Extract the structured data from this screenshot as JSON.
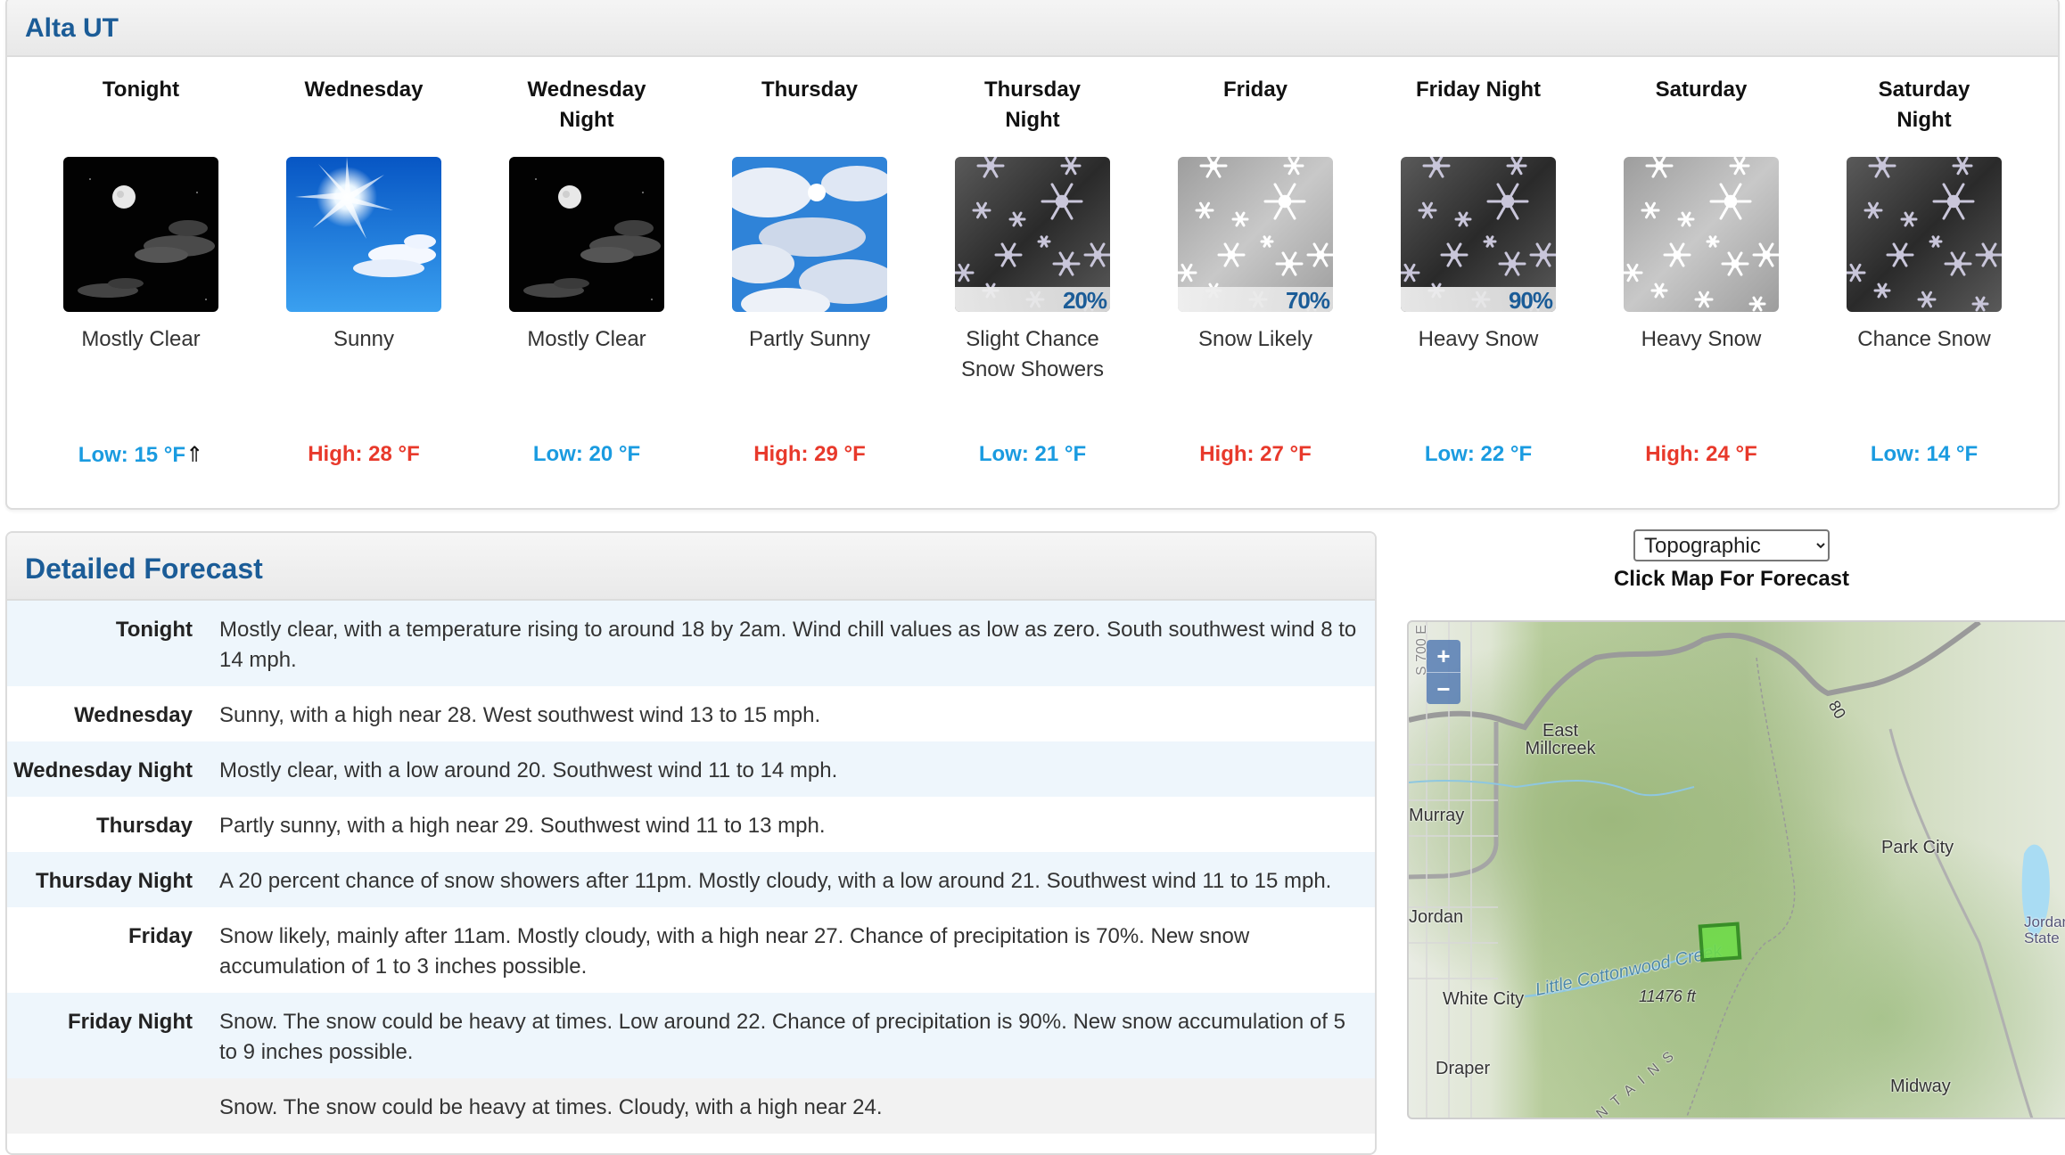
{
  "location": {
    "title": "Alta UT"
  },
  "periods": [
    {
      "name": "Tonight",
      "icon": "night-clear-moon-icon",
      "pop": null,
      "short_desc": "Mostly Clear",
      "temp_label": "Low: 15 °F",
      "temp_type": "low",
      "trend_icon": "rising-arrow-icon"
    },
    {
      "name": "Wednesday",
      "icon": "sunny-icon",
      "pop": null,
      "short_desc": "Sunny",
      "temp_label": "High: 28 °F",
      "temp_type": "high"
    },
    {
      "name": "Wednesday Night",
      "icon": "night-clear-moon-icon",
      "pop": null,
      "short_desc": "Mostly Clear",
      "temp_label": "Low: 20 °F",
      "temp_type": "low"
    },
    {
      "name": "Thursday",
      "icon": "partly-sunny-icon",
      "pop": null,
      "short_desc": "Partly Sunny",
      "temp_label": "High: 29 °F",
      "temp_type": "high"
    },
    {
      "name": "Thursday Night",
      "icon": "snow-night-icon",
      "pop": "20%",
      "short_desc": "Slight Chance Snow Showers",
      "temp_label": "Low: 21 °F",
      "temp_type": "low"
    },
    {
      "name": "Friday",
      "icon": "snow-day-icon",
      "pop": "70%",
      "short_desc": "Snow Likely",
      "temp_label": "High: 27 °F",
      "temp_type": "high"
    },
    {
      "name": "Friday Night",
      "icon": "snow-night-icon",
      "pop": "90%",
      "short_desc": "Heavy Snow",
      "temp_label": "Low: 22 °F",
      "temp_type": "low"
    },
    {
      "name": "Saturday",
      "icon": "snow-day-icon",
      "pop": null,
      "short_desc": "Heavy Snow",
      "temp_label": "High: 24 °F",
      "temp_type": "high"
    },
    {
      "name": "Saturday Night",
      "icon": "snow-night-icon",
      "pop": null,
      "short_desc": "Chance Snow",
      "temp_label": "Low: 14 °F",
      "temp_type": "low"
    }
  ],
  "detailed": {
    "title": "Detailed Forecast",
    "rows": [
      {
        "label": "Tonight",
        "text": "Mostly clear, with a temperature rising to around 18 by 2am. Wind chill values as low as zero. South southwest wind 8 to 14 mph."
      },
      {
        "label": "Wednesday",
        "text": "Sunny, with a high near 28. West southwest wind 13 to 15 mph."
      },
      {
        "label": "Wednesday Night",
        "text": "Mostly clear, with a low around 20. Southwest wind 11 to 14 mph."
      },
      {
        "label": "Thursday",
        "text": "Partly sunny, with a high near 29. Southwest wind 11 to 13 mph."
      },
      {
        "label": "Thursday Night",
        "text": "A 20 percent chance of snow showers after 11pm. Mostly cloudy, with a low around 21. Southwest wind 11 to 15 mph."
      },
      {
        "label": "Friday",
        "text": "Snow likely, mainly after 11am. Mostly cloudy, with a high near 27. Chance of precipitation is 70%. New snow accumulation of 1 to 3 inches possible."
      },
      {
        "label": "Friday Night",
        "text": "Snow. The snow could be heavy at times. Low around 22. Chance of precipitation is 90%. New snow accumulation of 5 to 9 inches possible."
      },
      {
        "label": "",
        "text": "Snow. The snow could be heavy at times. Cloudy, with a high near 24."
      }
    ]
  },
  "map": {
    "layer_selected": "Topographic",
    "caption": "Click Map For Forecast",
    "zoom_in": "+",
    "zoom_out": "−",
    "labels": {
      "east_millcreek": "East Millcreek",
      "murray": "Murray",
      "jordan": "Jordan",
      "white_city": "White City",
      "draper": "Draper",
      "park_city": "Park City",
      "jordanelle": "Jordanelle State",
      "midway": "Midway",
      "creek": "Little Cottonwood Creek",
      "elevation": "11476 ft",
      "interstate": "80",
      "street": "S 700 E",
      "range": "MOUNTAINS"
    }
  }
}
